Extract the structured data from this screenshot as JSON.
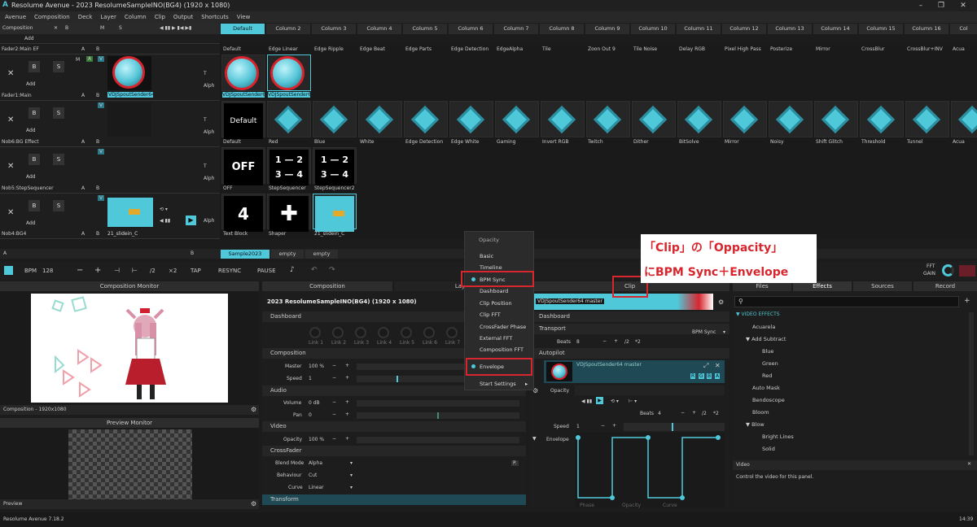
{
  "window": {
    "title": "Resolume Avenue - 2023 ResolumeSampleINO(BG4) (1920 x 1080)"
  },
  "menu": [
    "Avenue",
    "Composition",
    "Deck",
    "Layer",
    "Column",
    "Clip",
    "Output",
    "Shortcuts",
    "View"
  ],
  "comp_strip": {
    "label": "Composition",
    "a": "A",
    "b": "B",
    "m": "M",
    "s": "S",
    "alph": "Alph"
  },
  "columns": [
    "Default",
    "Column 2",
    "Column 3",
    "Column 4",
    "Column 5",
    "Column 6",
    "Column 7",
    "Column 8",
    "Column 9",
    "Column 10",
    "Column 11",
    "Column 12",
    "Column 13",
    "Column 14",
    "Column 15",
    "Column 16",
    "Col"
  ],
  "layers": [
    {
      "name": "Fader2:Main EF",
      "add": "Add"
    },
    {
      "name": "Fader1:Main",
      "add": "Add"
    },
    {
      "name": "Nob6:BG Effect",
      "add": "Add"
    },
    {
      "name": "Nob5:StepSequencer",
      "add": "Add"
    },
    {
      "name": "Nob4:BG4",
      "add": "Add"
    }
  ],
  "row1_clips": [
    "Default",
    "Edge Linear",
    "Edge Ripple",
    "Edge Beat",
    "Edge Parts",
    "Edge Detection",
    "EdgeAlpha",
    "Tile",
    "Zoon Out 9",
    "Tile Noise",
    "Delay RGB",
    "Pixel High Pass",
    "Posterize",
    "Mirror",
    "CrossBlur",
    "CrossBlur+INV",
    "Acua"
  ],
  "row2_clips": [
    "VDJSpoutSender64 m",
    "VDJSpoutSender64 m"
  ],
  "row2_layer_clip": "VDJSpoutSender64 m",
  "row3_clips": [
    "Default",
    "Red",
    "Blue",
    "White",
    "Edge Detection",
    "Edge White",
    "Gaming",
    "Invert RGB",
    "Twitch",
    "Dither",
    "BitSolve",
    "Mirror",
    "Noisy",
    "Shift Glitch",
    "Threshold",
    "Tunnel",
    "Acua"
  ],
  "row3_thumb_default": "Default",
  "row4_clips": [
    "OFF",
    "StepSequencer",
    "StepSequencer2"
  ],
  "row4_thumb_off": "OFF",
  "row5_clips": [
    "Text Block",
    "Shaper",
    "21_slidein_C"
  ],
  "row5_layer_clip": "21_slidein_C",
  "row5_thumb_text": "4",
  "deck": {
    "tabs": [
      "Sample2023",
      "empty",
      "empty"
    ],
    "a": "A",
    "b": "B"
  },
  "bpm_bar": {
    "bpm_label": "BPM",
    "bpm": "128",
    "minus": "−",
    "plus": "+",
    "div": "/2",
    "mul": "×2",
    "tap": "TAP",
    "resync": "RESYNC",
    "pause": "PAUSE",
    "fft": "FFT",
    "gain": "GAIN"
  },
  "comp_monitor": {
    "title": "Composition Monitor",
    "footer": "Composition - 1920x1080"
  },
  "preview_monitor": {
    "title": "Preview Monitor",
    "footer": "Preview"
  },
  "comp_panel": {
    "tabs": [
      "Composition",
      "Lay"
    ],
    "title": "2023 ResolumeSampleINO(BG4) (1920 x 1080)",
    "dashboard": "Dashboard",
    "links": [
      "Link 1",
      "Link 2",
      "Link 3",
      "Link 4",
      "Link 5",
      "Link 6",
      "Link 7"
    ],
    "composition": "Composition",
    "master_label": "Master",
    "master": "100 %",
    "speed_label": "Speed",
    "speed": "1",
    "audio": "Audio",
    "volume_label": "Volume",
    "volume": "0 dB",
    "pan_label": "Pan",
    "pan": "0",
    "video": "Video",
    "opacity_label": "Opacity",
    "opacity": "100 %",
    "crossfader": "CrossFader",
    "blend_label": "Blend Mode",
    "blend": "Alpha",
    "behaviour_label": "Behaviour",
    "behaviour": "Cut",
    "curve_label": "Curve",
    "curve": "Linear",
    "transform": "Transform"
  },
  "dropdown": {
    "header": "Opacity",
    "items": [
      "Basic",
      "Timeline",
      "BPM Sync",
      "Dashboard",
      "Clip Position",
      "Clip FFT",
      "CrossFader Phase",
      "External FFT",
      "Composition FFT",
      "Envelope",
      "Start Settings"
    ]
  },
  "annotation": {
    "line1": "「Clip」の「Oppacity」",
    "line2": "にBPM Sync＋Envelope"
  },
  "clip_panel": {
    "tab": "Clip",
    "clip_name": "VDJSpoutSender64 master",
    "dashboard": "Dashboard",
    "transport": "Transport",
    "transport_mode": "BPM Sync",
    "beats_label": "Beats",
    "beats": "8",
    "div": "/2",
    "mul": "*2",
    "autopilot": "Autopilot",
    "clip_source": "VDJSpoutSender64 master",
    "rgba": [
      "R",
      "G",
      "B",
      "A"
    ],
    "opacity_label": "Opacity",
    "beats2_label": "Beats",
    "beats2": "4",
    "speed_label": "Speed",
    "speed": "1",
    "envelope_label": "Envelope",
    "env_labels": [
      "Phase",
      "Opacity",
      "Curve"
    ]
  },
  "right_panel": {
    "tabs": [
      "Files",
      "Effects",
      "Sources",
      "Record"
    ],
    "section": "VIDEO EFFECTS",
    "items": [
      "Acuarela",
      "Add Subtract",
      "Blue",
      "Green",
      "Red",
      "Auto Mask",
      "Bendoscope",
      "Bloom",
      "Blow",
      "Bright Lines",
      "Solid"
    ],
    "help_title": "Video",
    "help_text": "Control the video for this panel."
  },
  "status": {
    "version": "Resolume Avenue 7.18.2",
    "time": "14:39"
  },
  "colors": {
    "accent": "#4fc9d9",
    "annotation_red": "#d7262e",
    "bg": "#1c1c1c"
  }
}
